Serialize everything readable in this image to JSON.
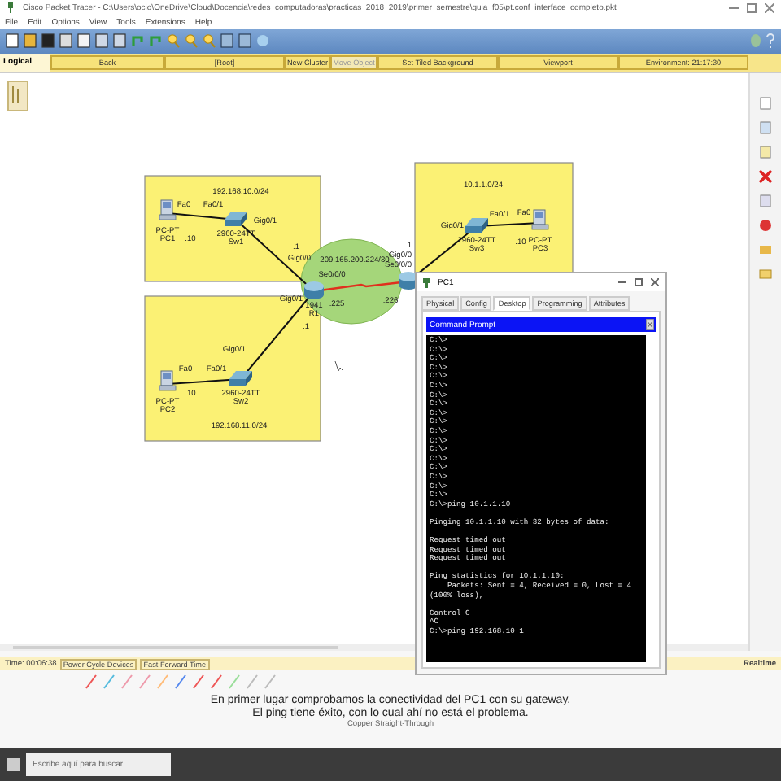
{
  "window": {
    "title": "Cisco Packet Tracer - C:\\Users\\ocio\\OneDrive\\Cloud\\Docencia\\redes_computadoras\\practicas_2018_2019\\primer_semestre\\guia_f05\\pt.conf_interface_completo.pkt"
  },
  "menu": [
    "File",
    "Edit",
    "Options",
    "View",
    "Tools",
    "Extensions",
    "Help"
  ],
  "workspace_bar": {
    "mode": "Logical",
    "buttons": [
      {
        "label": "Back",
        "disabled": false
      },
      {
        "label": "[Root]",
        "disabled": false
      },
      {
        "label": "New Cluster",
        "disabled": false
      },
      {
        "label": "Move Object",
        "disabled": true
      },
      {
        "label": "Set Tiled Background",
        "disabled": false
      },
      {
        "label": "Viewport",
        "disabled": false
      },
      {
        "label": "Environment: 21:17:30",
        "disabled": false
      }
    ]
  },
  "devices": [
    {
      "kind": "pc",
      "model": "PC-PT",
      "name": "PC1"
    },
    {
      "kind": "switch",
      "model": "2960-24TT",
      "name": "Sw1"
    },
    {
      "kind": "router",
      "model": "1941",
      "name": "R1"
    },
    {
      "kind": "pc",
      "model": "PC-PT",
      "name": "PC2"
    },
    {
      "kind": "switch",
      "model": "2960-24TT",
      "name": "Sw2"
    },
    {
      "kind": "switch",
      "model": "2960-24TT",
      "name": "Sw3"
    },
    {
      "kind": "pc",
      "model": "PC-PT",
      "name": "PC3"
    },
    {
      "kind": "router"
    }
  ],
  "links": [
    {
      "kind": "copper"
    },
    {
      "kind": "copper"
    },
    {
      "kind": "copper"
    },
    {
      "kind": "copper"
    },
    {
      "kind": "serial"
    },
    {
      "kind": "copper"
    },
    {
      "kind": "copper"
    }
  ],
  "labels": [
    "192.168.10.0/24",
    "Fa0",
    "Fa0/1",
    "Gig0/1",
    ".10",
    ".1",
    "Gig0/0",
    "Se0/0/0",
    ".225",
    "Gig0/1",
    ".1",
    "Gig0/1",
    "Fa0",
    "Fa0/1",
    ".10",
    "192.168.11.0/24",
    "209.165.200.224/30",
    ".1",
    "Gig0/0",
    "Se0/0/0",
    ".226",
    "10.1.1.0/24",
    "Gig0/1",
    "Fa0/1",
    "Fa0",
    ".10"
  ],
  "pc_window": {
    "title": "PC1",
    "tabs": [
      {
        "label": "Physical",
        "selected": false
      },
      {
        "label": "Config",
        "selected": false
      },
      {
        "label": "Desktop",
        "selected": true
      },
      {
        "label": "Programming",
        "selected": false
      },
      {
        "label": "Attributes",
        "selected": false
      }
    ],
    "app_title": "Command Prompt",
    "terminal": [
      {
        "text": "C:\\>"
      },
      {
        "text": "C:\\>"
      },
      {
        "text": "C:\\>"
      },
      {
        "text": "C:\\>"
      },
      {
        "text": "C:\\>"
      },
      {
        "text": "C:\\>"
      },
      {
        "text": "C:\\>"
      },
      {
        "text": "C:\\>"
      },
      {
        "text": "C:\\>"
      },
      {
        "text": "C:\\>"
      },
      {
        "text": "C:\\>"
      },
      {
        "text": "C:\\>"
      },
      {
        "text": "C:\\>"
      },
      {
        "text": "C:\\>"
      },
      {
        "text": "C:\\>"
      },
      {
        "text": "C:\\>"
      },
      {
        "text": "C:\\>"
      },
      {
        "text": "C:\\>"
      },
      {
        "text": "C:\\>ping 10.1.1.10"
      },
      {
        "text": "Pinging 10.1.1.10 with 32 bytes of data:",
        "gap_before": true
      },
      {
        "text": "Request timed out.",
        "gap_before": true
      },
      {
        "text": "Request timed out."
      },
      {
        "text": "Request timed out."
      },
      {
        "text": "Ping statistics for 10.1.1.10:",
        "gap_before": true
      },
      {
        "text": "    Packets: Sent = 4, Received = 0, Lost = 4 (100% loss),"
      },
      {
        "text": "Control-C",
        "gap_before": true
      },
      {
        "text": "^C"
      },
      {
        "text": "C:\\>ping 192.168.10.1"
      }
    ]
  },
  "bottom_bar": {
    "time": "Time: 00:06:38",
    "buttons": [
      "Power Cycle Devices",
      "Fast Forward Time"
    ],
    "mode": "Realtime",
    "connection": "Copper Straight-Through"
  },
  "subtitles": [
    "En primer lugar comprobamos la conectividad del PC1 con su gateway.",
    "El ping tiene éxito, con lo cual ahí no está el problema."
  ],
  "taskbar": {
    "search_placeholder": "Escribe aquí para buscar"
  }
}
